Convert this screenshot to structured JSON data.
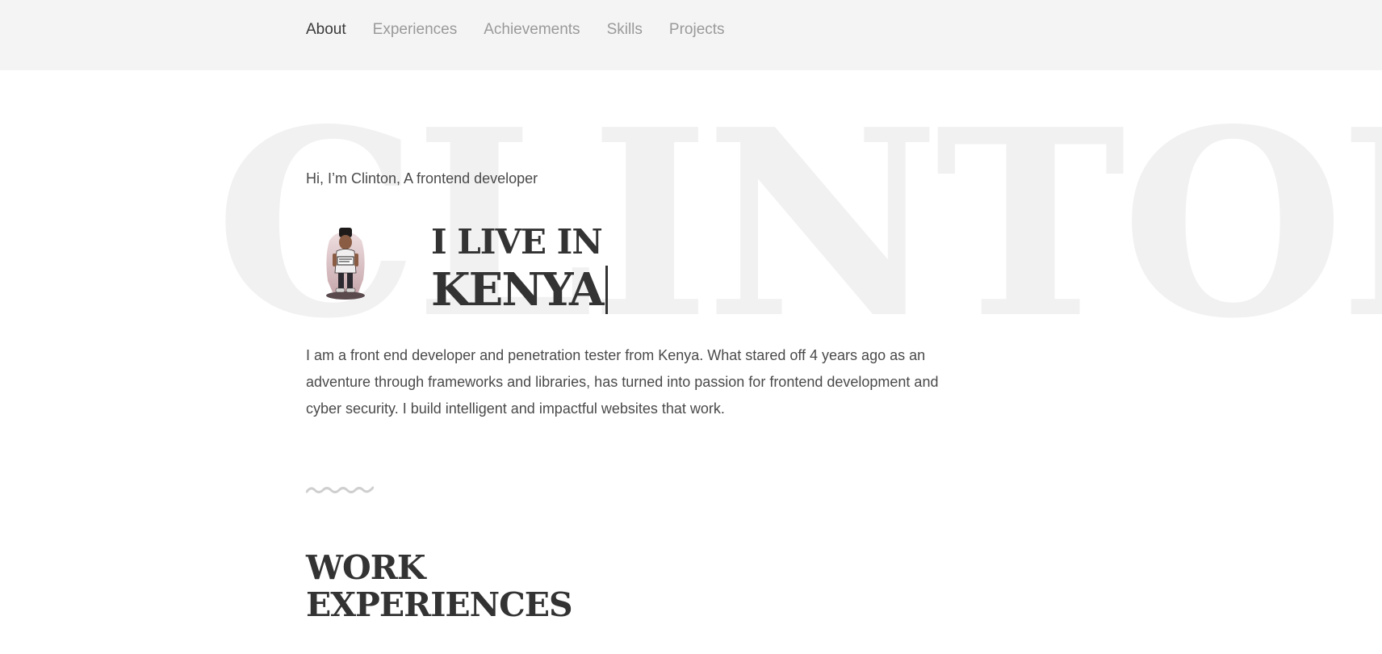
{
  "nav": {
    "items": [
      {
        "label": "About",
        "active": true
      },
      {
        "label": "Experiences",
        "active": false
      },
      {
        "label": "Achievements",
        "active": false
      },
      {
        "label": "Skills",
        "active": false
      },
      {
        "label": "Projects",
        "active": false
      }
    ]
  },
  "hero": {
    "watermark": "CLINTON",
    "greeting": "Hi, I’m Clinton, A frontend developer",
    "live_prefix": "I LIVE IN",
    "live_value": "KENYA",
    "avatar_icon": "developer-avatar-illustration"
  },
  "bio": {
    "text": "I am a front end developer and penetration tester from Kenya. What stared off 4 years ago as an adventure through frameworks and libraries, has turned into passion for frontend development and cyber security. I build intelligent and impactful websites that work."
  },
  "divider": {
    "icon": "squiggle-divider-icon"
  },
  "work_section": {
    "title_line1": "WORK",
    "title_line2": "EXPERIENCES"
  },
  "colors": {
    "nav_bg": "#f4f4f4",
    "text_dark": "#333333",
    "text_muted": "#9a9a9a",
    "watermark": "#f1f1f1"
  }
}
